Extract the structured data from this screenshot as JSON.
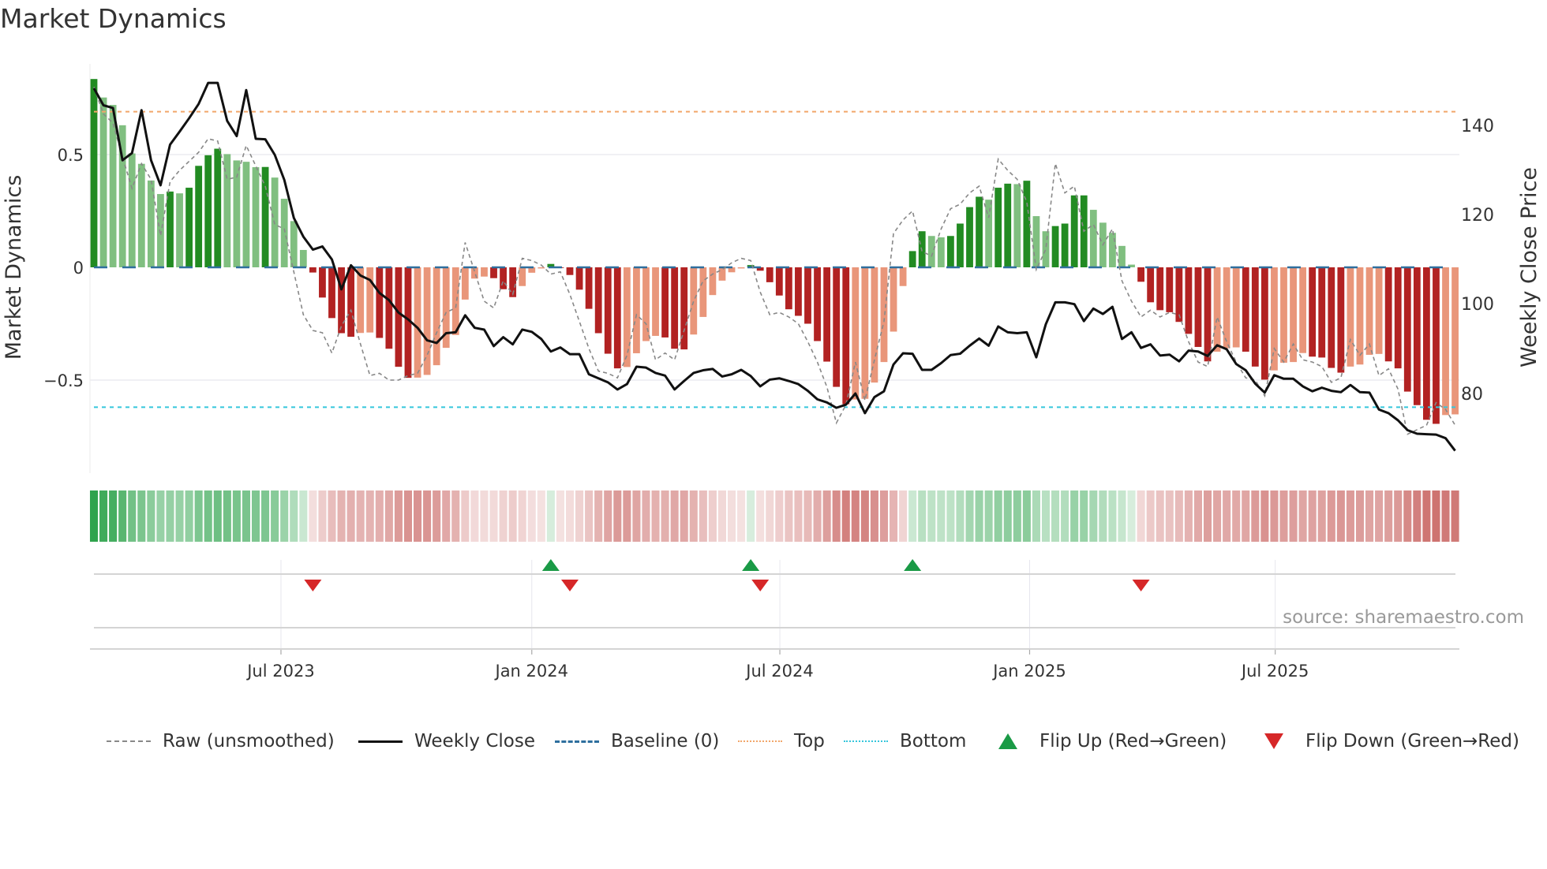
{
  "title": "Market Dynamics",
  "source": "source: sharemaestro.com",
  "legend": [
    {
      "label": "Raw (unsmoothed)",
      "style": "dashed",
      "color": "#888888"
    },
    {
      "label": "Weekly Close",
      "style": "solid",
      "color": "#111111"
    },
    {
      "label": "Baseline (0)",
      "style": "dashed",
      "color": "#2e6f9e"
    },
    {
      "label": "Top",
      "style": "dotted",
      "color": "#f2a66a"
    },
    {
      "label": "Bottom",
      "style": "dotted",
      "color": "#35c6dc"
    },
    {
      "label": "Flip Up (Red→Green)",
      "style": "triangle-up",
      "color": "#1a9a46"
    },
    {
      "label": "Flip Down (Green→Red)",
      "style": "triangle-down",
      "color": "#d62728"
    }
  ],
  "colors": {
    "green_strong": "#228b22",
    "green_weak": "#80bf80",
    "red_strong": "#b22222",
    "red_weak": "#e9967a",
    "strip_green": "#2ca24a",
    "strip_red": "#c55a57"
  },
  "chart_data": {
    "type": "bar",
    "title": "Market Dynamics",
    "xlabel": "",
    "ylabel": "Market Dynamics",
    "y2label": "Weekly Close Price",
    "frequency": "weekly",
    "ylim": [
      -0.92,
      0.86
    ],
    "y2lim": [
      62.5,
      152
    ],
    "y_ticks": [
      {
        "value": 0.5,
        "label": "0.5"
      },
      {
        "value": 0,
        "label": "0"
      },
      {
        "value": -0.5,
        "label": "−0.5"
      }
    ],
    "y2_ticks": [
      {
        "value": 140,
        "label": "140"
      },
      {
        "value": 120,
        "label": "120"
      },
      {
        "value": 100,
        "label": "100"
      },
      {
        "value": 80,
        "label": "80"
      }
    ],
    "x_ticks": [
      {
        "week": 19.65,
        "label": "Jul 2023"
      },
      {
        "week": 46.0,
        "label": "Jan 2024"
      },
      {
        "week": 72.06,
        "label": "Jul 2024"
      },
      {
        "week": 98.3,
        "label": "Jan 2025"
      },
      {
        "week": 124.1,
        "label": "Jul 2025"
      }
    ],
    "baseline": 0,
    "top": 0.69,
    "bottom": -0.62,
    "grid": true,
    "legend_position": "bottom",
    "smoothed": [
      0.835,
      0.753,
      0.72,
      0.63,
      0.505,
      0.459,
      0.385,
      0.325,
      0.336,
      0.328,
      0.353,
      0.45,
      0.497,
      0.526,
      0.502,
      0.474,
      0.468,
      0.444,
      0.445,
      0.398,
      0.304,
      0.205,
      0.077,
      -0.023,
      -0.134,
      -0.225,
      -0.292,
      -0.308,
      -0.291,
      -0.289,
      -0.313,
      -0.361,
      -0.441,
      -0.49,
      -0.489,
      -0.477,
      -0.434,
      -0.357,
      -0.3,
      -0.143,
      -0.05,
      -0.041,
      -0.048,
      -0.097,
      -0.132,
      -0.083,
      -0.024,
      -0.005,
      0.015,
      -0.003,
      -0.034,
      -0.099,
      -0.184,
      -0.292,
      -0.383,
      -0.448,
      -0.442,
      -0.381,
      -0.327,
      -0.304,
      -0.311,
      -0.361,
      -0.364,
      -0.298,
      -0.22,
      -0.123,
      -0.059,
      -0.022,
      -0.005,
      0.01,
      -0.015,
      -0.066,
      -0.125,
      -0.186,
      -0.215,
      -0.25,
      -0.327,
      -0.418,
      -0.53,
      -0.607,
      -0.586,
      -0.583,
      -0.511,
      -0.42,
      -0.285,
      -0.083,
      0.072,
      0.16,
      0.139,
      0.133,
      0.139,
      0.194,
      0.267,
      0.313,
      0.3,
      0.353,
      0.371,
      0.369,
      0.384,
      0.227,
      0.16,
      0.183,
      0.194,
      0.319,
      0.319,
      0.255,
      0.198,
      0.153,
      0.095,
      0.012,
      -0.064,
      -0.155,
      -0.19,
      -0.199,
      -0.242,
      -0.295,
      -0.353,
      -0.417,
      -0.374,
      -0.359,
      -0.355,
      -0.374,
      -0.44,
      -0.498,
      -0.457,
      -0.423,
      -0.42,
      -0.38,
      -0.396,
      -0.4,
      -0.446,
      -0.467,
      -0.44,
      -0.431,
      -0.388,
      -0.384,
      -0.417,
      -0.448,
      -0.551,
      -0.611,
      -0.676,
      -0.694,
      -0.655,
      -0.652
    ],
    "raw": [
      0.8,
      0.68,
      0.64,
      0.49,
      0.35,
      0.46,
      0.39,
      0.14,
      0.38,
      0.43,
      0.47,
      0.51,
      0.57,
      0.56,
      0.39,
      0.4,
      0.54,
      0.45,
      0.36,
      0.19,
      0.17,
      -0.02,
      -0.21,
      -0.28,
      -0.29,
      -0.38,
      -0.26,
      -0.19,
      -0.34,
      -0.48,
      -0.47,
      -0.5,
      -0.5,
      -0.48,
      -0.47,
      -0.39,
      -0.29,
      -0.2,
      -0.18,
      0.11,
      -0.02,
      -0.15,
      -0.18,
      -0.06,
      -0.12,
      0.04,
      0.03,
      0.01,
      -0.03,
      -0.02,
      -0.12,
      -0.24,
      -0.36,
      -0.46,
      -0.47,
      -0.49,
      -0.39,
      -0.21,
      -0.25,
      -0.41,
      -0.38,
      -0.41,
      -0.28,
      -0.15,
      -0.06,
      -0.03,
      -0.01,
      0.02,
      0.04,
      0.03,
      -0.11,
      -0.21,
      -0.2,
      -0.22,
      -0.25,
      -0.33,
      -0.42,
      -0.53,
      -0.69,
      -0.61,
      -0.42,
      -0.59,
      -0.41,
      -0.24,
      0.15,
      0.21,
      0.25,
      0.07,
      0.05,
      0.17,
      0.26,
      0.28,
      0.33,
      0.36,
      0.22,
      0.48,
      0.43,
      0.39,
      0.29,
      -0.01,
      0.08,
      0.46,
      0.33,
      0.36,
      0.16,
      0.19,
      0.1,
      0.17,
      -0.06,
      -0.15,
      -0.22,
      -0.19,
      -0.22,
      -0.2,
      -0.21,
      -0.33,
      -0.42,
      -0.44,
      -0.22,
      -0.33,
      -0.42,
      -0.49,
      -0.5,
      -0.57,
      -0.36,
      -0.42,
      -0.34,
      -0.41,
      -0.42,
      -0.44,
      -0.51,
      -0.49,
      -0.32,
      -0.39,
      -0.34,
      -0.48,
      -0.45,
      -0.54,
      -0.74,
      -0.72,
      -0.7,
      -0.6,
      -0.63,
      -0.7
    ],
    "close": [
      148.3,
      144.5,
      143.9,
      132.2,
      133.8,
      143.4,
      132.2,
      126.6,
      135.7,
      138.6,
      141.6,
      144.8,
      149.5,
      149.5,
      141,
      137.6,
      147.9,
      137,
      136.9,
      133.4,
      127.8,
      119.3,
      115.1,
      112.2,
      112.9,
      110,
      103.3,
      108.7,
      106.4,
      105.4,
      102.5,
      100.9,
      98.1,
      96.6,
      94.7,
      91.9,
      91.3,
      93.5,
      93.7,
      97.5,
      94.7,
      94.3,
      90.6,
      92.6,
      91,
      94.3,
      93.8,
      92.2,
      89.4,
      90.3,
      88.8,
      88.8,
      84.3,
      83.4,
      82.5,
      80.9,
      82.1,
      86,
      85.8,
      84.6,
      84,
      80.9,
      82.8,
      84.6,
      85.2,
      85.5,
      83.8,
      84.3,
      85.3,
      83.9,
      81.6,
      83.1,
      83.4,
      82.8,
      82.1,
      80.6,
      78.7,
      78,
      76.8,
      77.5,
      80,
      75.6,
      79.2,
      80.5,
      86.5,
      89,
      88.9,
      85.3,
      85.3,
      86.8,
      88.6,
      88.9,
      90.7,
      92.3,
      90.7,
      95,
      93.7,
      93.5,
      93.7,
      88.1,
      95.5,
      100.4,
      100.4,
      100,
      96.2,
      99,
      97.8,
      99.4,
      92.2,
      93.7,
      90.2,
      91,
      88.5,
      88.7,
      87.2,
      89.6,
      89.4,
      88.4,
      90.8,
      89.9,
      86.6,
      85.2,
      82.2,
      80.2,
      84.1,
      83.3,
      83.3,
      81.6,
      80.5,
      81.3,
      80.6,
      80.3,
      81.9,
      80.3,
      80.2,
      76.4,
      75.6,
      74,
      71.8,
      71,
      70.9,
      70.8,
      70,
      67.2
    ],
    "flip_up_weeks": [
      48,
      69,
      86
    ],
    "flip_down_weeks": [
      23,
      50,
      70,
      110
    ]
  }
}
